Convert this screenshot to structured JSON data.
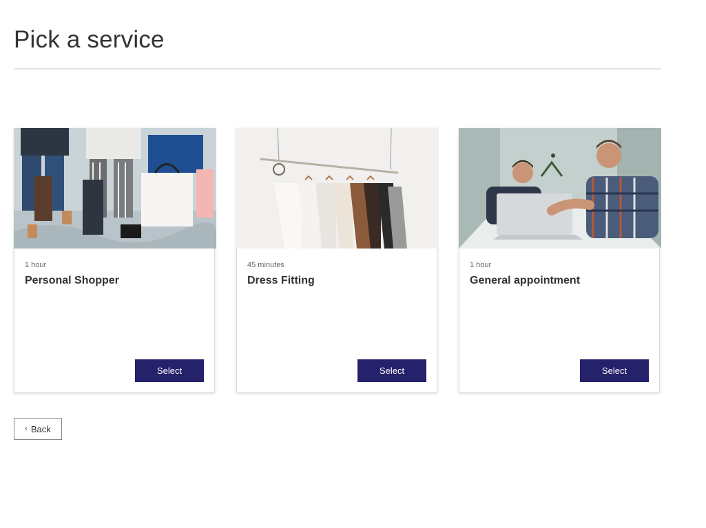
{
  "page": {
    "title": "Pick a service"
  },
  "services": [
    {
      "duration": "1 hour",
      "name": "Personal Shopper",
      "image": "shoppers-with-bags-photo",
      "button_label": "Select"
    },
    {
      "duration": "45 minutes",
      "name": "Dress Fitting",
      "image": "clothing-rack-photo",
      "button_label": "Select"
    },
    {
      "duration": "1 hour",
      "name": "General appointment",
      "image": "meeting-with-laptop-photo",
      "button_label": "Select"
    }
  ],
  "navigation": {
    "back_label": "Back",
    "back_icon": "chevron-left-icon"
  },
  "colors": {
    "primary_button": "#25216b",
    "divider": "#e2e2e2"
  }
}
